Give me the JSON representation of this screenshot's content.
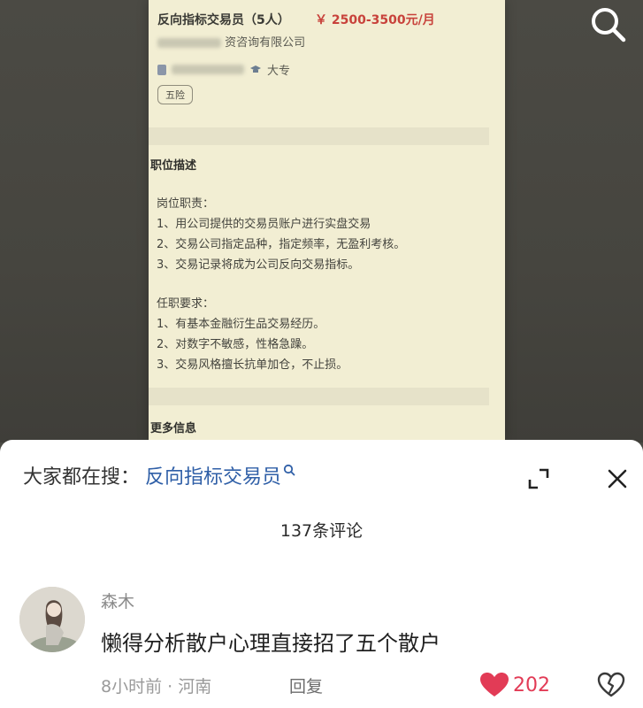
{
  "posting": {
    "title": "反向指标交易员（5人）",
    "salary": "￥ 2500-3500元/月",
    "company_suffix": "资咨询有限公司",
    "education": "大专",
    "benefit_tag": "五险",
    "section_description": "职位描述",
    "duties_heading": "岗位职责：",
    "duties": [
      "1、用公司提供的交易员账户进行实盘交易",
      "2、交易公司指定品种，指定频率，无盈利考核。",
      "3、交易记录将成为公司反向交易指标。"
    ],
    "requirements_heading": "任职要求：",
    "requirements": [
      "1、有基本金融衍生品交易经历。",
      "2、对数字不敏感，性格急躁。",
      "3、交易风格擅长抗单加仓，不止损。"
    ],
    "section_more": "更多信息"
  },
  "comments": {
    "trend_prefix": "大家都在搜：",
    "trend_query": "反向指标交易员",
    "count_label": "137条评论",
    "items": [
      {
        "username": "森木",
        "text": "懒得分析散户心理直接招了五个散户",
        "meta": "8小时前 · 河南",
        "reply_label": "回复",
        "likes": "202"
      }
    ]
  },
  "icons": {
    "search": "search-icon",
    "expand": "expand-icon",
    "close": "close-icon",
    "like": "heart-icon",
    "dislike": "broken-heart-icon"
  },
  "colors": {
    "link": "#2f5fa7",
    "like": "#e23b56",
    "salary": "#c8423b",
    "posting_bg": "#f2eed3"
  }
}
